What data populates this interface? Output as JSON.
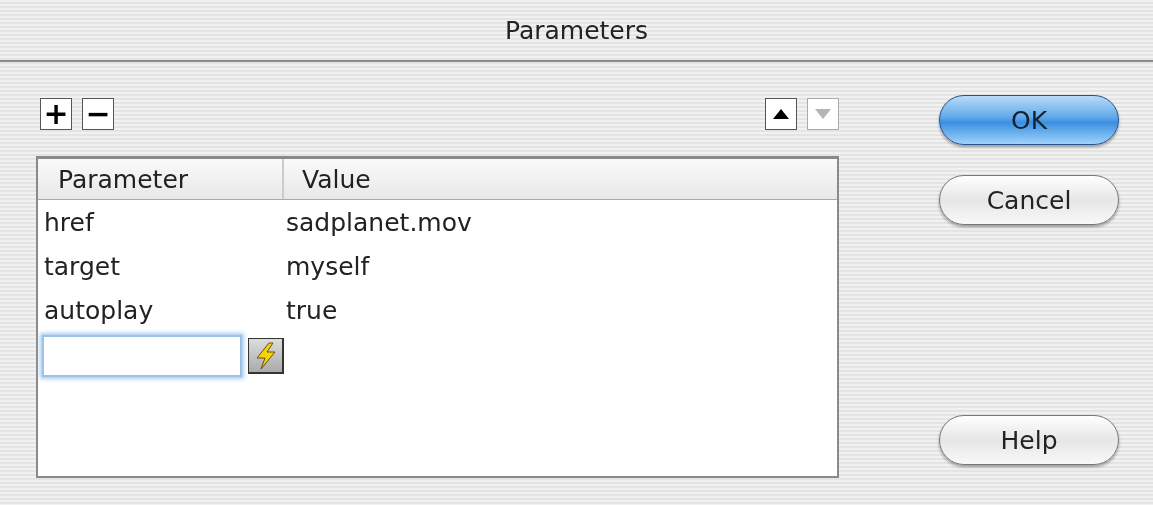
{
  "window": {
    "title": "Parameters"
  },
  "toolbar": {
    "add": {
      "label": "+"
    },
    "remove": {
      "label": "−"
    },
    "move_up": {
      "disabled": false
    },
    "move_down": {
      "disabled": true
    }
  },
  "table": {
    "columns": [
      "Parameter",
      "Value"
    ],
    "rows": [
      {
        "parameter": "href",
        "value": "sadplanet.mov"
      },
      {
        "parameter": "target",
        "value": "myself"
      },
      {
        "parameter": "autoplay",
        "value": "true"
      }
    ],
    "new_row": {
      "focused": true
    }
  },
  "buttons": [
    {
      "label": "OK",
      "default": true
    },
    {
      "label": "Cancel",
      "default": false
    },
    {
      "label": "Help",
      "default": false
    }
  ]
}
